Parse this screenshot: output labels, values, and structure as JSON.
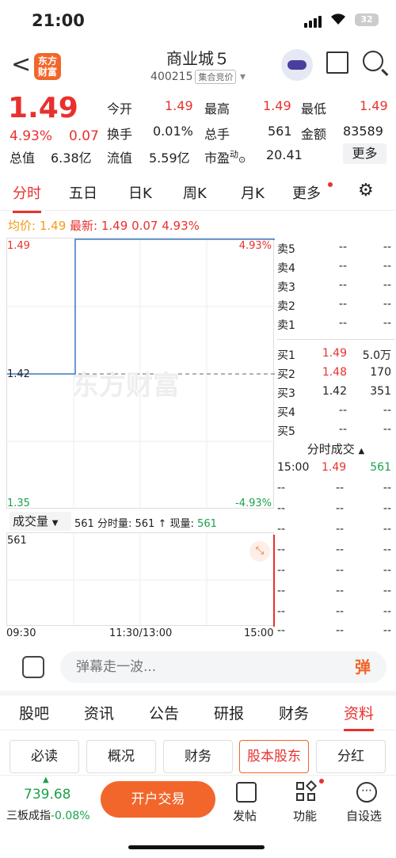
{
  "status": {
    "time": "21:00",
    "battery": "32"
  },
  "nav": {
    "title": "商业城５",
    "code": "400215",
    "tag": "集合竞价",
    "logo_line1": "东方",
    "logo_line2": "财富"
  },
  "quote": {
    "price": "1.49",
    "change_pct": "4.93%",
    "change": "0.07",
    "open_label": "今开",
    "open": "1.49",
    "high_label": "最高",
    "high": "1.49",
    "low_label": "最低",
    "low": "1.49",
    "turnover_label": "换手",
    "turnover": "0.01%",
    "volume_label": "总手",
    "volume": "561",
    "amount_label": "金额",
    "amount": "83589",
    "mktcap_label": "总值",
    "mktcap": "6.38亿",
    "float_label": "流值",
    "float": "5.59亿",
    "pe_label": "市盈",
    "pe_sup": "动",
    "pe": "20.41",
    "more": "更多"
  },
  "tabs": [
    "分时",
    "五日",
    "日K",
    "周K",
    "月K",
    "更多"
  ],
  "info": {
    "avg_label": "均价:",
    "avg": "1.49",
    "last_label": "最新:",
    "last": "1.49",
    "chg": "0.07",
    "pct": "4.93%"
  },
  "chart": {
    "top_price": "1.49",
    "top_pct": "4.93%",
    "mid_price": "1.42",
    "bot_price": "1.35",
    "bot_pct": "-4.93%",
    "watermark": "东方财富"
  },
  "volume": {
    "select": "成交量",
    "desc_val": "561",
    "desc1": "分时量:",
    "desc2": "561",
    "desc3": "↑",
    "desc4": "现量:",
    "desc5": "561",
    "axis_val": "561",
    "x_start": "09:30",
    "x_mid": "11:30/13:00",
    "x_end": "15:00"
  },
  "orderbook": {
    "asks": [
      {
        "l": "卖5",
        "p": "--",
        "v": "--"
      },
      {
        "l": "卖4",
        "p": "--",
        "v": "--"
      },
      {
        "l": "卖3",
        "p": "--",
        "v": "--"
      },
      {
        "l": "卖2",
        "p": "--",
        "v": "--"
      },
      {
        "l": "卖1",
        "p": "--",
        "v": "--"
      }
    ],
    "bids": [
      {
        "l": "买1",
        "p": "1.49",
        "v": "5.0万"
      },
      {
        "l": "买2",
        "p": "1.48",
        "v": "170"
      },
      {
        "l": "买3",
        "p": "1.42",
        "v": "351"
      },
      {
        "l": "买4",
        "p": "--",
        "v": "--"
      },
      {
        "l": "买5",
        "p": "--",
        "v": "--"
      }
    ]
  },
  "trades": {
    "title": "分时成交",
    "first": {
      "t": "15:00",
      "p": "1.49",
      "v": "561"
    },
    "empty": "--"
  },
  "danmu": {
    "placeholder": "弹幕走一波...",
    "btn": "弹"
  },
  "sections": [
    "股吧",
    "资讯",
    "公告",
    "研报",
    "财务",
    "资料"
  ],
  "subtabs": [
    "必读",
    "概况",
    "财务",
    "股本股东",
    "分红"
  ],
  "bottom": {
    "index_val": "739.68",
    "index_name": "三板成指",
    "index_pct": "-0.08%",
    "trade": "开户交易",
    "post": "发帖",
    "func": "功能",
    "custom": "自设选"
  },
  "colors": {
    "up": "#e8312f",
    "down": "#1aa34a",
    "accent": "#f2662b",
    "line": "#3a79c2"
  }
}
